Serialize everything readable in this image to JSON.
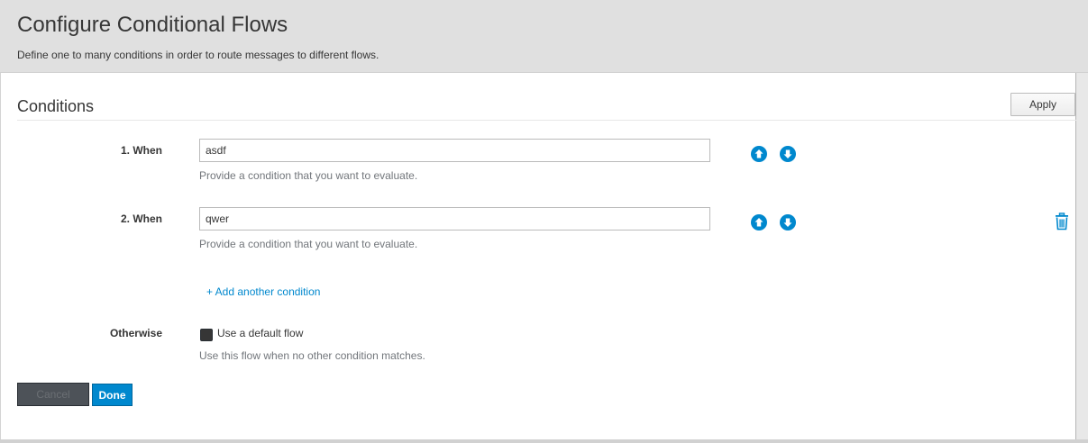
{
  "header": {
    "title": "Configure Conditional Flows",
    "subtitle": "Define one to many conditions in order to route messages to different flows."
  },
  "section": {
    "title": "Conditions",
    "apply_label": "Apply"
  },
  "conditions": [
    {
      "label": "1. When",
      "value": "asdf",
      "help": "Provide a condition that you want to evaluate."
    },
    {
      "label": "2. When",
      "value": "qwer",
      "help": "Provide a condition that you want to evaluate."
    }
  ],
  "add_condition_label": "+ Add another condition",
  "otherwise": {
    "label": "Otherwise",
    "checkbox_label": "Use a default flow",
    "help": "Use this flow when no other condition matches."
  },
  "footer": {
    "cancel_label": "Cancel",
    "done_label": "Done"
  },
  "colors": {
    "accent": "#0088ce",
    "header_bg": "#e0e0e0"
  },
  "icons": {
    "move_up": "arrow-circle-up-icon",
    "move_down": "arrow-circle-down-icon",
    "delete": "trash-icon"
  }
}
